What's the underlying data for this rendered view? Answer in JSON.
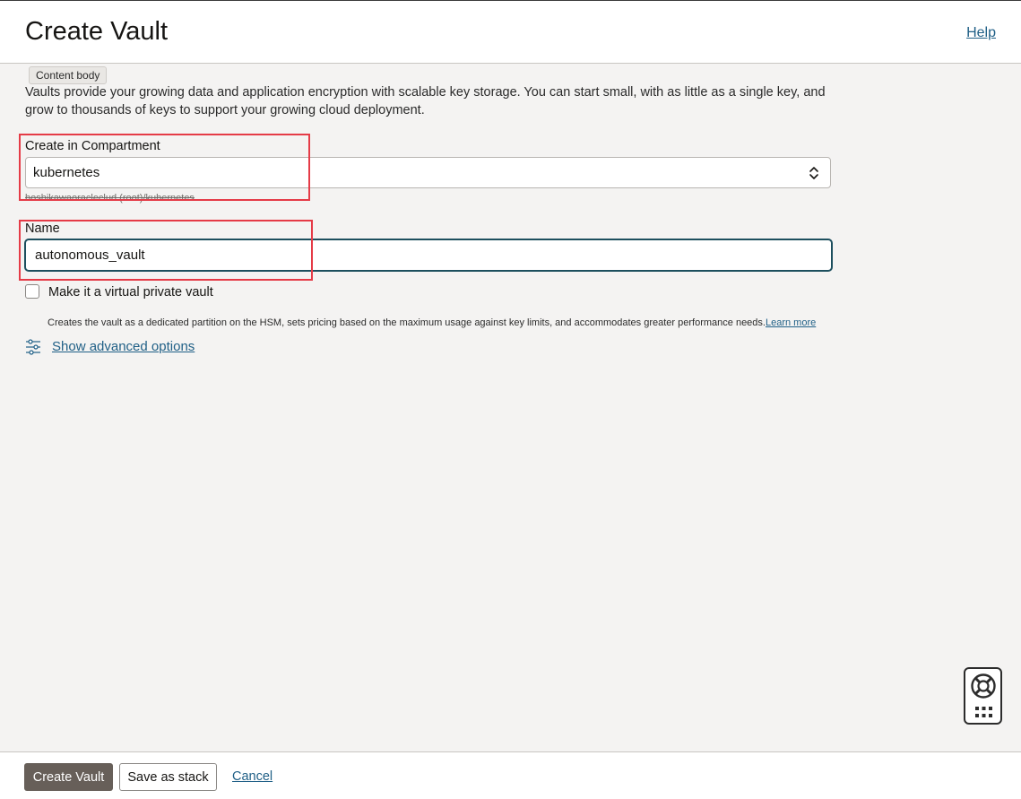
{
  "header": {
    "title": "Create Vault",
    "help_label": "Help"
  },
  "tooltip": {
    "text": "Content body"
  },
  "description": "Vaults provide your growing data and application encryption with scalable key storage. You can start small, with as little as a single key, and grow to thousands of keys to support your growing cloud deployment.",
  "compartment": {
    "label": "Create in Compartment",
    "value": "kubernetes",
    "path": "hoshikawaoracleclud (root)/kubernetes"
  },
  "name_field": {
    "label": "Name",
    "value": "autonomous_vault"
  },
  "virtual_private": {
    "label": "Make it a virtual private vault",
    "checked": false,
    "helper": "Creates the vault as a dedicated partition on the HSM, sets pricing based on the maximum usage against key limits, and accommodates greater performance needs.",
    "learn_more": "Learn more"
  },
  "advanced": {
    "label": "Show advanced options"
  },
  "footer": {
    "create_label": "Create Vault",
    "save_stack_label": "Save as stack",
    "cancel_label": "Cancel"
  },
  "colors": {
    "link": "#1f5f86",
    "primary_button": "#675f59",
    "highlight": "#e53b47",
    "focus_border": "#1d4f5e"
  },
  "icons": {
    "select": "chevron-up-down-icon",
    "advanced": "sliders-icon",
    "support": "lifebuoy-icon",
    "apps": "grid-icon"
  }
}
